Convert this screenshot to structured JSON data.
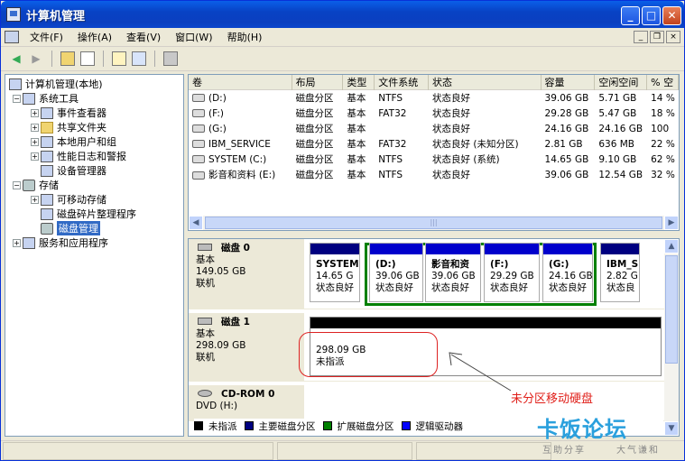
{
  "window": {
    "title": "计算机管理"
  },
  "menu": [
    "文件(F)",
    "操作(A)",
    "查看(V)",
    "窗口(W)",
    "帮助(H)"
  ],
  "tree": {
    "root": "计算机管理(本地)",
    "system_tools": "系统工具",
    "event_viewer": "事件查看器",
    "shared_folders": "共享文件夹",
    "local_users": "本地用户和组",
    "perf_logs": "性能日志和警报",
    "device_manager": "设备管理器",
    "storage": "存储",
    "removable": "可移动存储",
    "defrag": "磁盘碎片整理程序",
    "disk_mgmt": "磁盘管理",
    "services": "服务和应用程序"
  },
  "list": {
    "columns": [
      "卷",
      "布局",
      "类型",
      "文件系统",
      "状态",
      "容量",
      "空闲空间",
      "% 空"
    ],
    "rows": [
      [
        "(D:)",
        "磁盘分区",
        "基本",
        "NTFS",
        "状态良好",
        "39.06 GB",
        "5.71 GB",
        "14 %"
      ],
      [
        "(F:)",
        "磁盘分区",
        "基本",
        "FAT32",
        "状态良好",
        "29.28 GB",
        "5.47 GB",
        "18 %"
      ],
      [
        "(G:)",
        "磁盘分区",
        "基本",
        "",
        "状态良好",
        "24.16 GB",
        "24.16 GB",
        "100"
      ],
      [
        "IBM_SERVICE",
        "磁盘分区",
        "基本",
        "FAT32",
        "状态良好 (未知分区)",
        "2.81 GB",
        "636 MB",
        "22 %"
      ],
      [
        "SYSTEM (C:)",
        "磁盘分区",
        "基本",
        "NTFS",
        "状态良好 (系统)",
        "14.65 GB",
        "9.10 GB",
        "62 %"
      ],
      [
        "影音和资料 (E:)",
        "磁盘分区",
        "基本",
        "NTFS",
        "状态良好",
        "39.06 GB",
        "12.54 GB",
        "32 %"
      ]
    ]
  },
  "disks": {
    "disk0": {
      "name": "磁盘 0",
      "type": "基本",
      "size": "149.05 GB",
      "status": "联机",
      "parts": [
        {
          "name": "SYSTEM",
          "size": "14.65 G",
          "status": "状态良好"
        },
        {
          "name": "(D:)",
          "size": "39.06 GB",
          "status": "状态良好"
        },
        {
          "name": "影音和资",
          "size": "39.06 GB",
          "status": "状态良好"
        },
        {
          "name": "(F:)",
          "size": "29.29 GB",
          "status": "状态良好"
        },
        {
          "name": "(G:)",
          "size": "24.16 GB",
          "status": "状态良好"
        },
        {
          "name": "IBM_S",
          "size": "2.82 G",
          "status": "状态良"
        }
      ]
    },
    "disk1": {
      "name": "磁盘 1",
      "type": "基本",
      "size": "298.09 GB",
      "status": "联机",
      "part": {
        "size": "298.09 GB",
        "status": "未指派"
      }
    },
    "cdrom": {
      "name": "CD-ROM 0",
      "type": "DVD (H:)"
    }
  },
  "legend": [
    "未指派",
    "主要磁盘分区",
    "扩展磁盘分区",
    "逻辑驱动器"
  ],
  "colors": {
    "unallocated": "#000000",
    "primary": "#000080",
    "extended": "#008000",
    "logical": "#0000ff",
    "accent": "#0a4fd6"
  },
  "annotation": "未分区移动硬盘",
  "watermark": {
    "logo": "卡饭论坛",
    "sub1": "互助分享",
    "sub2": "大气谦和"
  }
}
